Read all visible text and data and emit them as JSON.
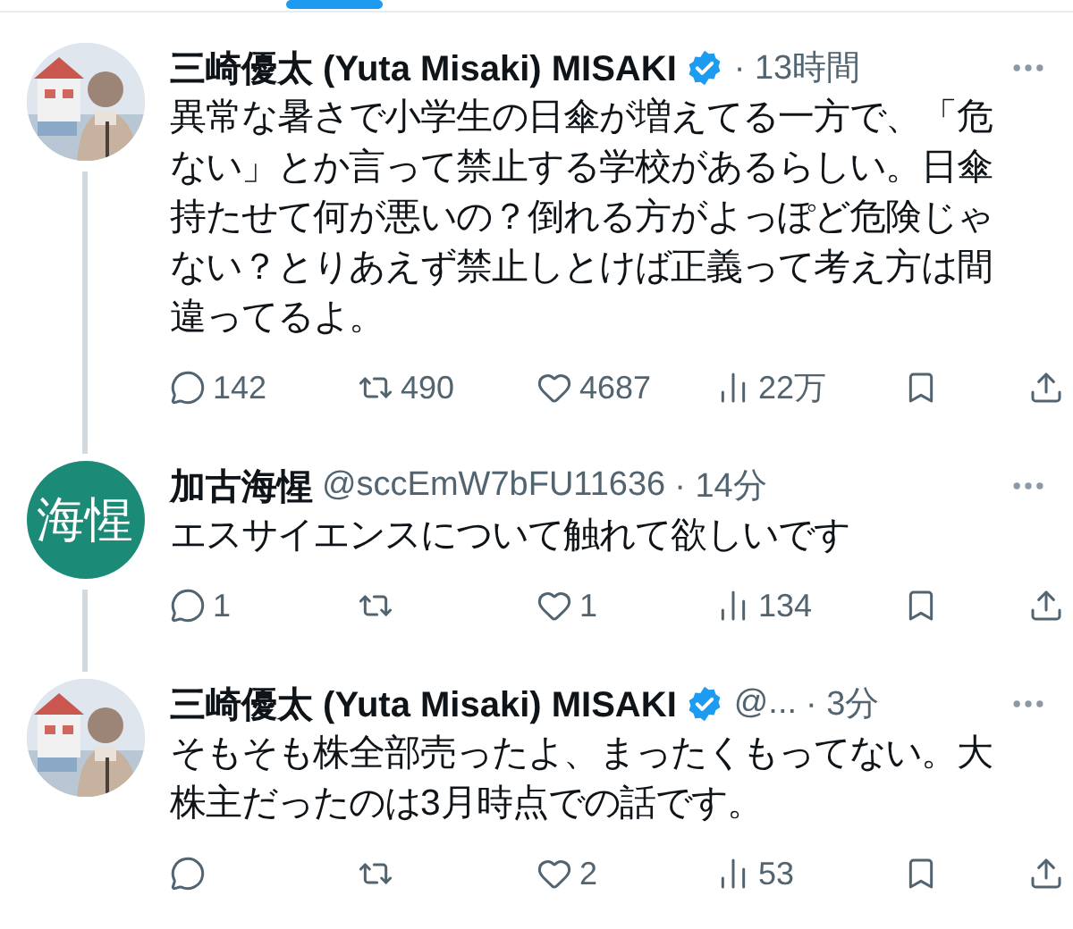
{
  "tweets": [
    {
      "author": "三崎優太 (Yuta Misaki) MISAKI",
      "verified": true,
      "time": "· 13時間",
      "thread_continues": true,
      "text": "異常な暑さで小学生の日傘が増えてる一方で、「危ない」とか言って禁止する学校があるらしい。日傘持たせて何が悪いの？倒れる方がよっぽど危険じゃない？とりあえず禁止しとけば正義って考え方は間違ってるよ。",
      "stats": {
        "replies": "142",
        "retweets": "490",
        "likes": "4687",
        "views": "22万"
      }
    },
    {
      "author": "加古海惺",
      "verified": false,
      "handle": "@sccEmW7bFU11636",
      "time": "· 14分",
      "avatar": {
        "kind": "initials",
        "label": "海惺",
        "color": "#1b8a76"
      },
      "thread_continues": true,
      "text": "エスサイエンスについて触れて欲しいです",
      "stats": {
        "replies": "1",
        "likes": "1",
        "views": "134"
      }
    },
    {
      "author": "三崎優太 (Yuta Misaki) MISAKI",
      "verified": true,
      "handle": "@...",
      "time": "· 3分",
      "thread_continues": false,
      "text": "そもそも株全部売ったよ、まったくもってない。大株主だったのは3月時点での話です。",
      "stats": {
        "likes": "2",
        "views": "53"
      }
    }
  ]
}
